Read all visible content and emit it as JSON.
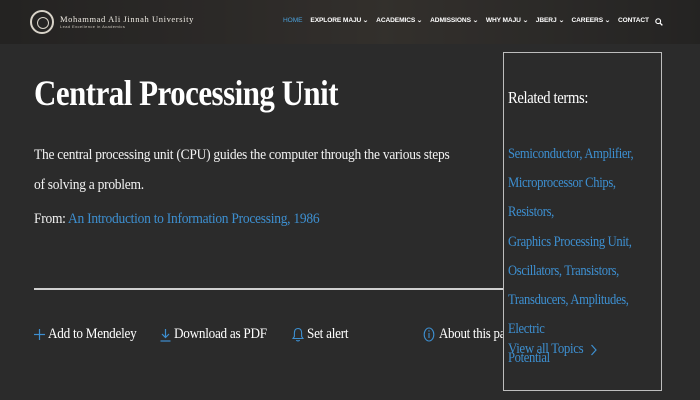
{
  "header": {
    "brand_name": "Mohammad Ali Jinnah University",
    "brand_tagline": "Lead Excellence in Academics",
    "nav": [
      {
        "label": "HOME",
        "active": true,
        "dropdown": false
      },
      {
        "label": "EXPLORE MAJU",
        "active": false,
        "dropdown": true
      },
      {
        "label": "ACADEMICS",
        "active": false,
        "dropdown": true
      },
      {
        "label": "ADMISSIONS",
        "active": false,
        "dropdown": true
      },
      {
        "label": "WHY MAJU",
        "active": false,
        "dropdown": true
      },
      {
        "label": "JBERJ",
        "active": false,
        "dropdown": true
      },
      {
        "label": "CAREERS",
        "active": false,
        "dropdown": true
      },
      {
        "label": "CONTACT",
        "active": false,
        "dropdown": false
      }
    ],
    "search_icon": "search-icon"
  },
  "main": {
    "title": "Central Processing Unit",
    "definition": "The central processing unit (CPU) guides the computer through the various steps of solving a problem.",
    "source_prefix": "From:",
    "source_link": "An Introduction to Information Processing, 1986",
    "actions": [
      {
        "label": "Add to Mendeley",
        "icon": "plus-icon"
      },
      {
        "label": "Download as PDF",
        "icon": "download-icon"
      },
      {
        "label": "Set alert",
        "icon": "bell-icon"
      }
    ],
    "about_label": "About this page",
    "about_icon": "info-icon"
  },
  "related": {
    "title": "Related terms:",
    "terms": [
      "Semiconductor",
      "Amplifier",
      "Microprocessor Chips",
      "Resistors",
      "Graphics Processing Unit",
      "Oscillators",
      "Transistors",
      "Transducers",
      "Amplitudes",
      "Electric Potential"
    ],
    "view_all": "View all Topics"
  },
  "colors": {
    "background": "#2b2b2b",
    "link": "#3d8fd0",
    "nav_active": "#4a9fd8",
    "text": "#ffffff"
  }
}
